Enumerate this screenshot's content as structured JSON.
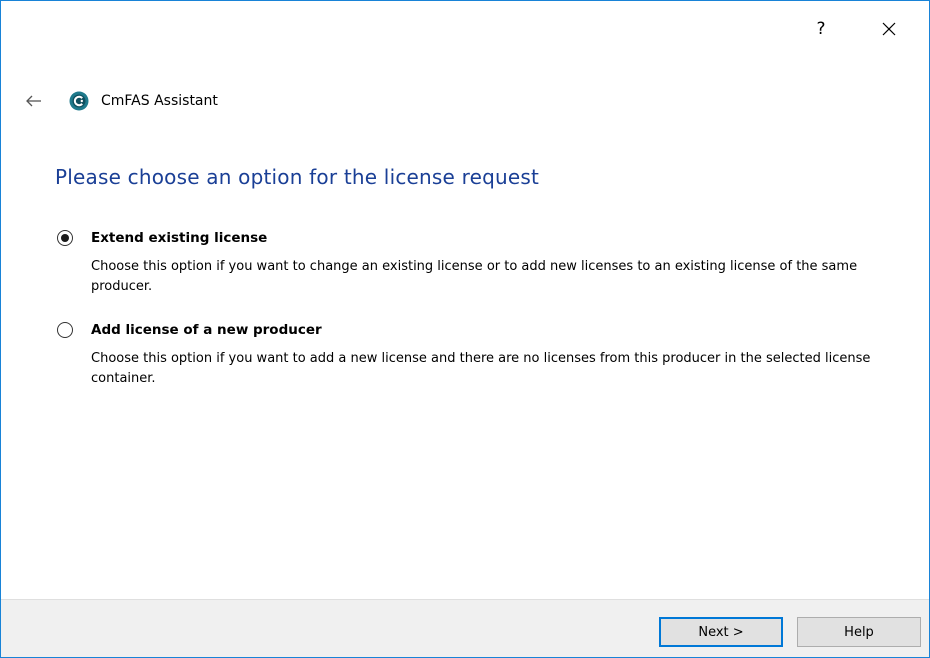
{
  "titlebar": {
    "help_label": "?"
  },
  "header": {
    "app_title": "CmFAS Assistant"
  },
  "page": {
    "heading": "Please choose an option for the license request"
  },
  "options": [
    {
      "label": "Extend existing license",
      "description": "Choose this option if you want to change an existing license or to add new licenses to an existing license of the same producer.",
      "selected": true
    },
    {
      "label": "Add license of a new producer",
      "description": "Choose this option if you want to add a new license and there are no licenses from this producer in the selected license container.",
      "selected": false
    }
  ],
  "footer": {
    "next_label": "Next >",
    "help_label": "Help"
  },
  "colors": {
    "heading": "#1a3f96",
    "window_border": "#1883d7",
    "footer_bg": "#f0f0f0",
    "default_button_border": "#0078d7",
    "app_icon": "#1f7a8c"
  },
  "icons": {
    "back": "back-arrow-icon",
    "app": "cmfas-logo-icon",
    "close": "close-icon"
  }
}
